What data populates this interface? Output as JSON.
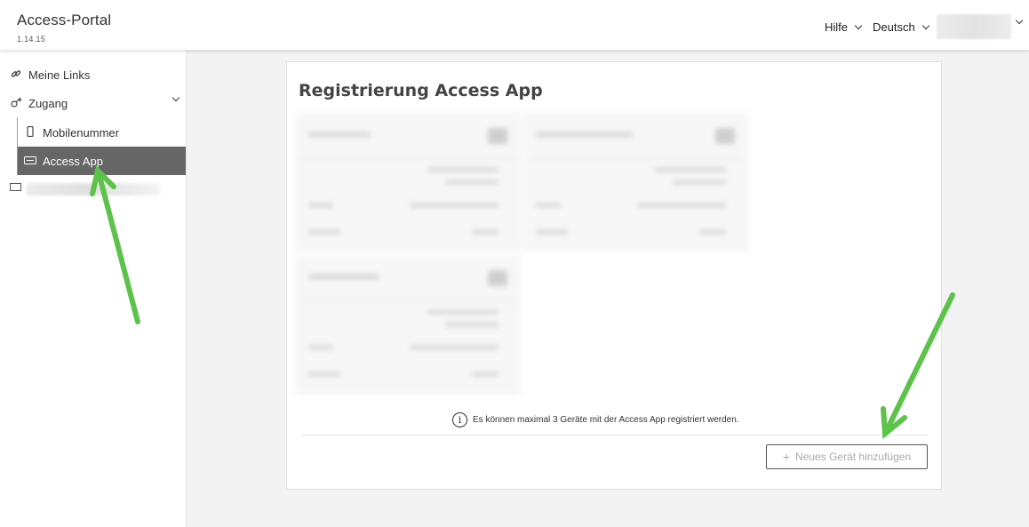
{
  "header": {
    "title": "Access-Portal",
    "version": "1.14.15",
    "help_label": "Hilfe",
    "language_label": "Deutsch"
  },
  "sidebar": {
    "items": [
      {
        "label": "Meine Links",
        "icon": "link-icon"
      },
      {
        "label": "Zugang",
        "icon": "key-icon"
      },
      {
        "label": "Mobilenummer",
        "icon": "phone-icon"
      },
      {
        "label": "Access App",
        "icon": "keyboard-icon",
        "active": true
      }
    ]
  },
  "main": {
    "title": "Registrierung Access App",
    "info_text": "Es können maximal 3 Geräte mit der Access App registriert werden.",
    "add_button_label": "Neues Gerät hinzufügen",
    "add_button_icon": "+"
  },
  "colors": {
    "active_item_bg": "#666666",
    "annotation_arrow": "#5cc24a"
  }
}
